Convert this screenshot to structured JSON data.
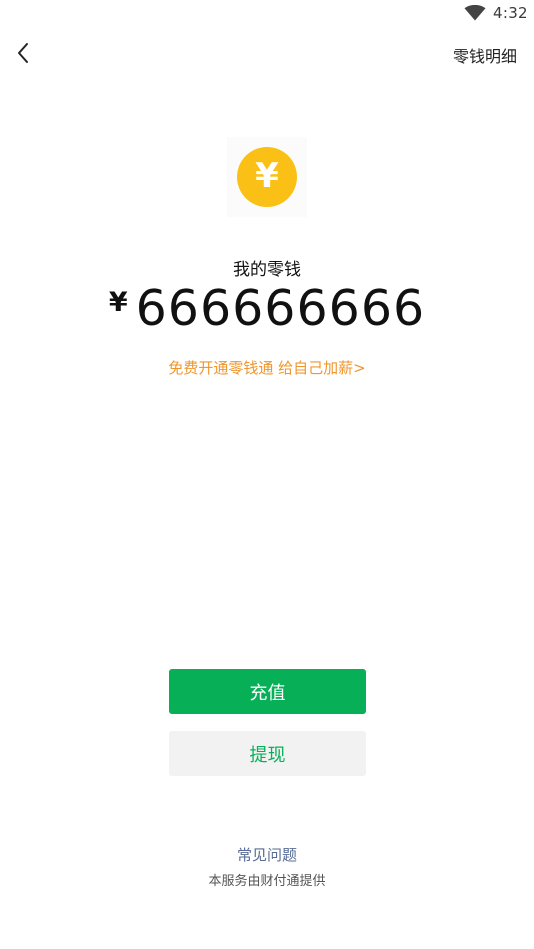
{
  "status_bar": {
    "time": "4:32",
    "wifi_icon": "wifi-icon"
  },
  "header": {
    "back_icon": "chevron-left-icon",
    "detail_link": "零钱明细"
  },
  "wallet": {
    "coin_icon": "yuan-coin-icon",
    "coin_glyph": "¥",
    "coin_color": "#fbc016",
    "label": "我的零钱",
    "currency_symbol": "¥",
    "amount": "666666666"
  },
  "promo": {
    "text": "免费开通零钱通 给自己加薪>",
    "color": "#f0962c"
  },
  "actions": {
    "recharge_label": "充值",
    "withdraw_label": "提现",
    "accent_color": "#07b057"
  },
  "footer": {
    "faq_link": "常见问题",
    "provider_note": "本服务由财付通提供",
    "link_color": "#576b95"
  }
}
